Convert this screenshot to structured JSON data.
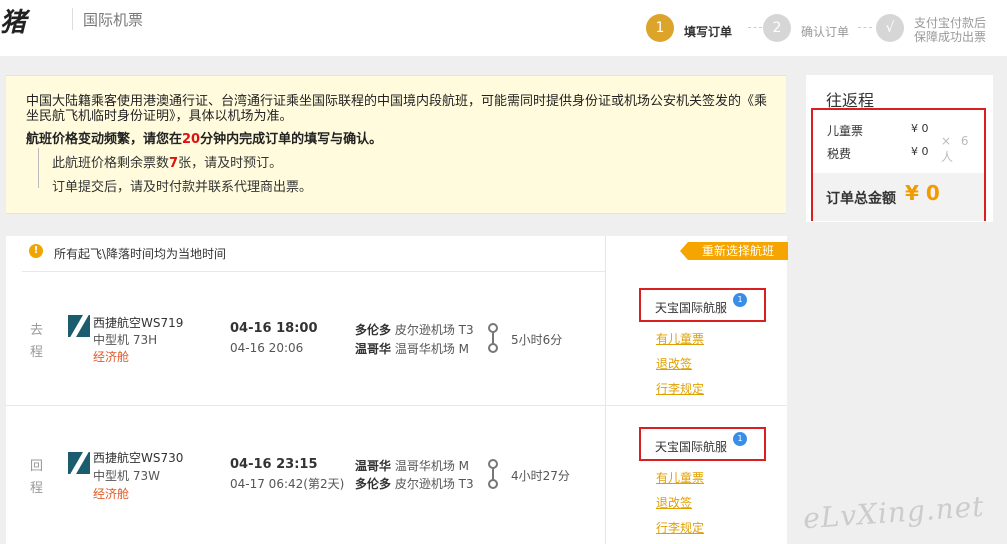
{
  "header": {
    "logo": "猪",
    "title": "国际机票",
    "steps": [
      {
        "num": "1",
        "label": "填写订单"
      },
      {
        "num": "2",
        "label": "确认订单"
      },
      {
        "num": "√",
        "label": "支付宝付款后保障成功出票"
      }
    ]
  },
  "notice": {
    "paragraph": "中国大陆籍乘客使用港澳通行证、台湾通行证乘坐国际联程的中国境内段航班，可能需同时提供身份证或机场公安机关签发的《乘坐民航飞机临时身份证明》，具体以机场为准。",
    "price_prefix": "航班价格变动频繁，请您在",
    "price_minutes": "20",
    "price_suffix": "分钟内完成订单的填写与确认。",
    "remain_prefix": "此航班价格剩余票数",
    "remain_count": "7",
    "remain_suffix": "张，请及时预订。",
    "submit_tip": "订单提交后，请及时付款并联系代理商出票。"
  },
  "summary": {
    "title": "往返程",
    "child_label": "儿童票",
    "child_value": "¥ 0",
    "tax_label": "税费",
    "tax_value": "¥ 0",
    "multiplier": "× 6 人",
    "total_label": "订单总金额",
    "total_value": "¥ 0"
  },
  "flights": {
    "info": "所有起飞\\降落时间均为当地时间",
    "reselect": "重新选择航班",
    "trips": [
      {
        "direction": "去程",
        "airline": "西捷航空WS719",
        "plane": "中型机 73H",
        "cabin": "经济舱",
        "dep_time": "04-16 18:00",
        "arr_time": "04-16 20:06",
        "dep_city": "多伦多",
        "dep_airport": "皮尔逊机场 T3",
        "arr_city": "温哥华",
        "arr_airport": "温哥华机场 M",
        "duration": "5小时6分",
        "service": "天宝国际航服",
        "badge": "1",
        "link_child": "有儿童票",
        "link_change": "退改签",
        "link_baggage": "行李规定"
      },
      {
        "direction": "回程",
        "airline": "西捷航空WS730",
        "plane": "中型机 73W",
        "cabin": "经济舱",
        "dep_time": "04-16 23:15",
        "arr_time": "04-17 06:42(第2天)",
        "dep_city": "温哥华",
        "dep_airport": "温哥华机场 M",
        "arr_city": "多伦多",
        "arr_airport": "皮尔逊机场 T3",
        "duration": "4小时27分",
        "service": "天宝国际航服",
        "badge": "1",
        "link_child": "有儿童票",
        "link_change": "退改签",
        "link_baggage": "行李规定"
      }
    ]
  },
  "watermark": "eLvXing.net"
}
